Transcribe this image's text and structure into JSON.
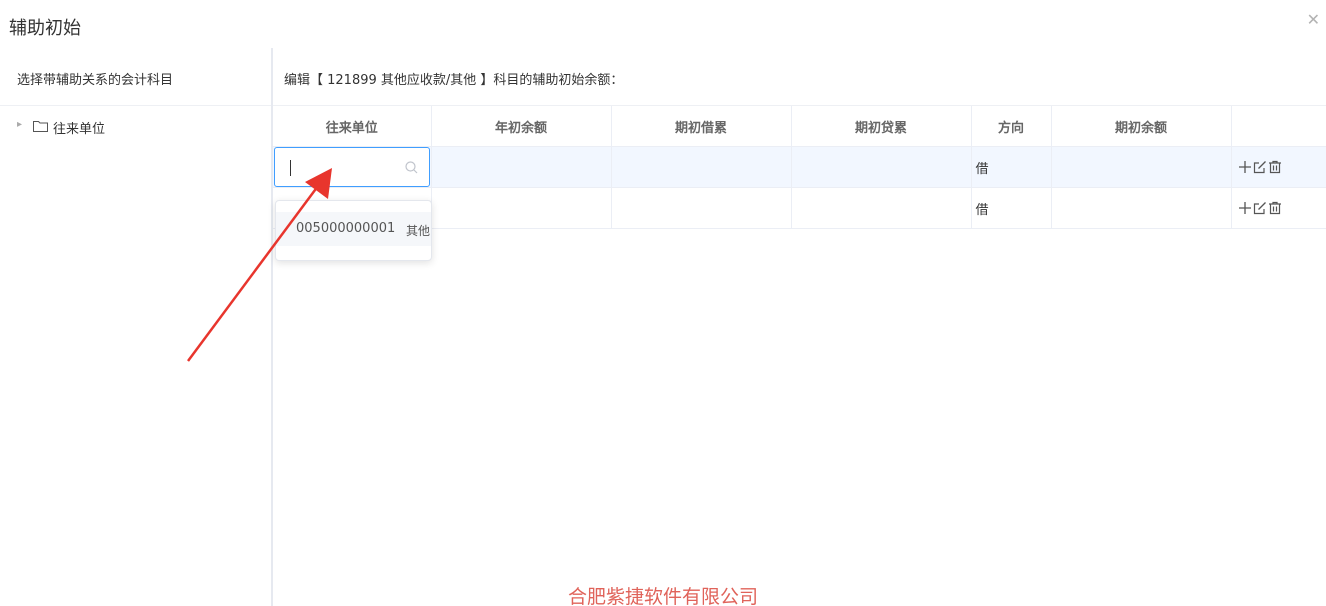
{
  "dialog": {
    "title": "辅助初始",
    "close_icon": "close-icon"
  },
  "left": {
    "header": "选择带辅助关系的会计科目",
    "tree": [
      {
        "label": "往来单位",
        "icon": "folder-icon"
      }
    ]
  },
  "right": {
    "header": "编辑【 121899 其他应收款/其他 】科目的辅助初始余额：",
    "columns": [
      "往来单位",
      "年初余额",
      "期初借累",
      "期初贷累",
      "方向",
      "期初余额",
      ""
    ],
    "rows": [
      {
        "unit": "",
        "year_balance": "",
        "debit": "",
        "credit": "",
        "direction": "借",
        "balance": ""
      },
      {
        "unit": "",
        "year_balance": "",
        "debit": "",
        "credit": "",
        "direction": "借",
        "balance": ""
      }
    ],
    "search": {
      "value": "",
      "placeholder": ""
    },
    "dropdown": [
      {
        "code": "005000000001",
        "name": "其他"
      }
    ]
  },
  "colors": {
    "accent": "#409eff",
    "arrow": "#e8352d",
    "watermark": "#e0635a",
    "active_row": "#f2f7ff"
  },
  "watermark": "合肥紫捷软件有限公司"
}
